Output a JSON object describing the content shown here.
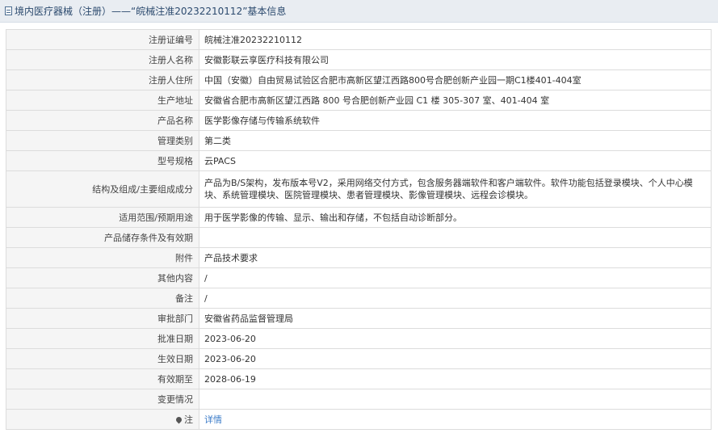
{
  "header": {
    "title": "境内医疗器械（注册）——“皖械注准20232210112”基本信息",
    "icon": "document-icon"
  },
  "rows": [
    {
      "label": "注册证编号",
      "value": "皖械注准20232210112"
    },
    {
      "label": "注册人名称",
      "value": "安徽影联云享医疗科技有限公司"
    },
    {
      "label": "注册人住所",
      "value": "中国（安徽）自由贸易试验区合肥市高新区望江西路800号合肥创新产业园一期C1楼401-404室"
    },
    {
      "label": "生产地址",
      "value": "安徽省合肥市高新区望江西路 800 号合肥创新产业园 C1 楼 305-307 室、401-404 室"
    },
    {
      "label": "产品名称",
      "value": "医学影像存储与传输系统软件"
    },
    {
      "label": "管理类别",
      "value": "第二类"
    },
    {
      "label": "型号规格",
      "value": "云PACS"
    },
    {
      "label": "结构及组成/主要组成成分",
      "value": "产品为B/S架构，发布版本号V2，采用网络交付方式，包含服务器端软件和客户端软件。软件功能包括登录模块、个人中心模块、系统管理模块、医院管理模块、患者管理模块、影像管理模块、远程会诊模块。"
    },
    {
      "label": "适用范围/预期用途",
      "value": "用于医学影像的传输、显示、输出和存储，不包括自动诊断部分。"
    },
    {
      "label": "产品储存条件及有效期",
      "value": ""
    },
    {
      "label": "附件",
      "value": "产品技术要求"
    },
    {
      "label": "其他内容",
      "value": "/"
    },
    {
      "label": "备注",
      "value": "/"
    },
    {
      "label": "审批部门",
      "value": "安徽省药品监督管理局"
    },
    {
      "label": "批准日期",
      "value": "2023-06-20"
    },
    {
      "label": "生效日期",
      "value": "2023-06-20"
    },
    {
      "label": "有效期至",
      "value": "2028-06-19"
    },
    {
      "label": "变更情况",
      "value": ""
    }
  ],
  "note": {
    "label": "注",
    "link": "详情",
    "icon": "pin-icon"
  }
}
